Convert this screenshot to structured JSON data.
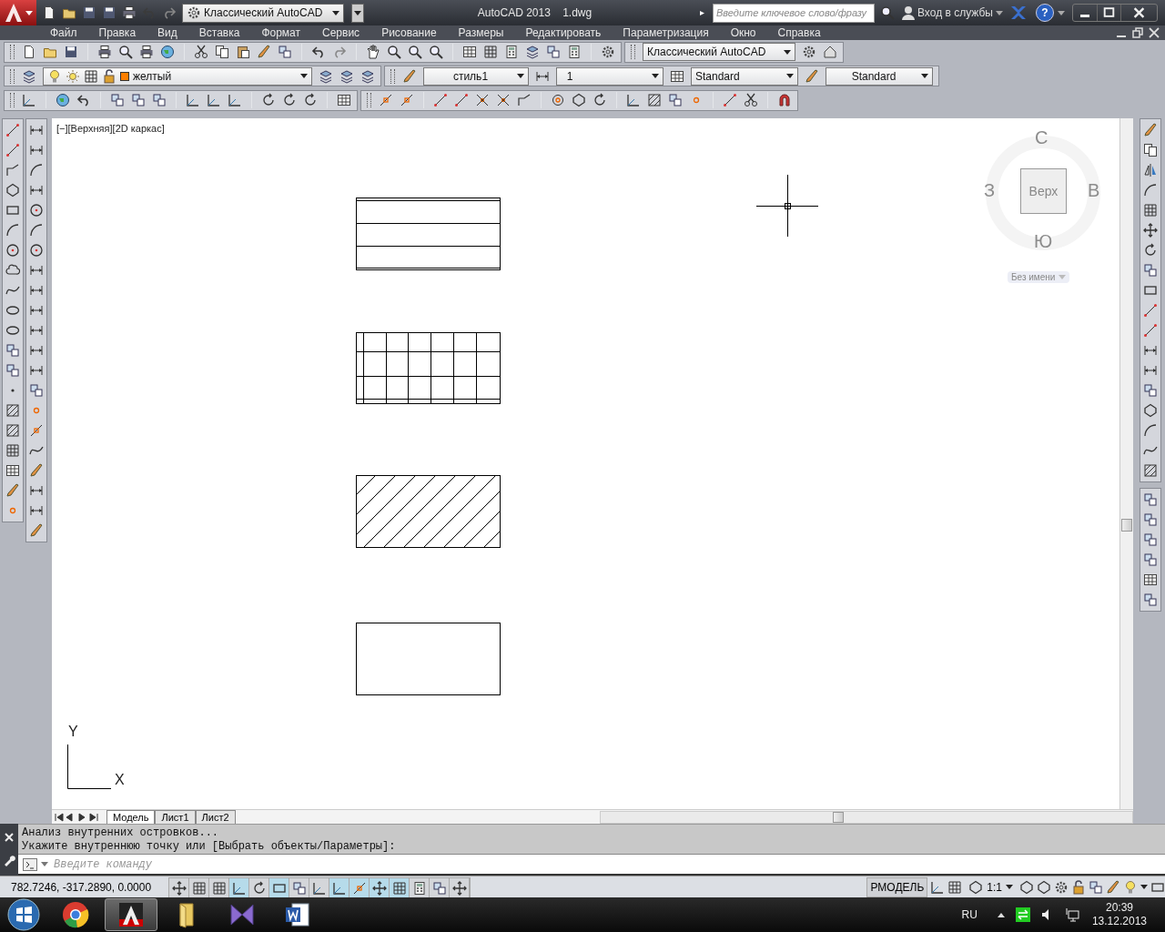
{
  "title_bar": {
    "workspace": "Классический AutoCAD",
    "app_name": "AutoCAD 2013",
    "file_name": "1.dwg",
    "search": {
      "placeholder": "Введите ключевое слово/фразу"
    },
    "sign_in": "Вход в службы",
    "help": "?"
  },
  "menu": [
    "Файл",
    "Правка",
    "Вид",
    "Вставка",
    "Формат",
    "Сервис",
    "Рисование",
    "Размеры",
    "Редактировать",
    "Параметризация",
    "Окно",
    "Справка"
  ],
  "toolbars": {
    "workspace": "Классический AutoCAD",
    "layer": {
      "name": "желтый",
      "color": "#ff7f00"
    },
    "text_style": "стиль1",
    "dim_scale": "1",
    "table_style": "Standard",
    "multileader_style": "Standard"
  },
  "viewport_label": "[−][Верхняя][2D каркас]",
  "viewcube": {
    "north": "С",
    "west": "З",
    "east": "В",
    "south": "Ю",
    "face": "Верх",
    "ucs_name": "Без имени"
  },
  "ucs_icon": {
    "y_label": "Y",
    "x_label": "X"
  },
  "layout_tabs": [
    {
      "label": "Модель",
      "selected": true
    },
    {
      "label": "Лист1",
      "selected": false
    },
    {
      "label": "Лист2",
      "selected": false
    }
  ],
  "command": {
    "history": [
      "Анализ внутренних островков...",
      "Укажите внутреннюю точку или [Выбрать объекты/Параметры]:"
    ],
    "placeholder": "Введите команду"
  },
  "status_bar": {
    "coordinates": "782.7246, -317.2890, 0.0000",
    "toggles": [
      {
        "on": false
      },
      {
        "on": false
      },
      {
        "on": false
      },
      {
        "on": true
      },
      {
        "on": false
      },
      {
        "on": true
      },
      {
        "on": false
      },
      {
        "on": false
      },
      {
        "on": true
      },
      {
        "on": true
      },
      {
        "on": true
      },
      {
        "on": true
      },
      {
        "on": false
      },
      {
        "on": false
      },
      {
        "on": false
      }
    ],
    "space": "РМОДЕЛЬ",
    "annotation_scale": "1:1"
  },
  "taskbar": {
    "apps": [
      {
        "selected": false
      },
      {
        "selected": true
      },
      {
        "selected": false
      },
      {
        "selected": false
      },
      {
        "selected": false
      }
    ],
    "language": "RU",
    "time": "20:39",
    "date": "13.12.2013"
  }
}
